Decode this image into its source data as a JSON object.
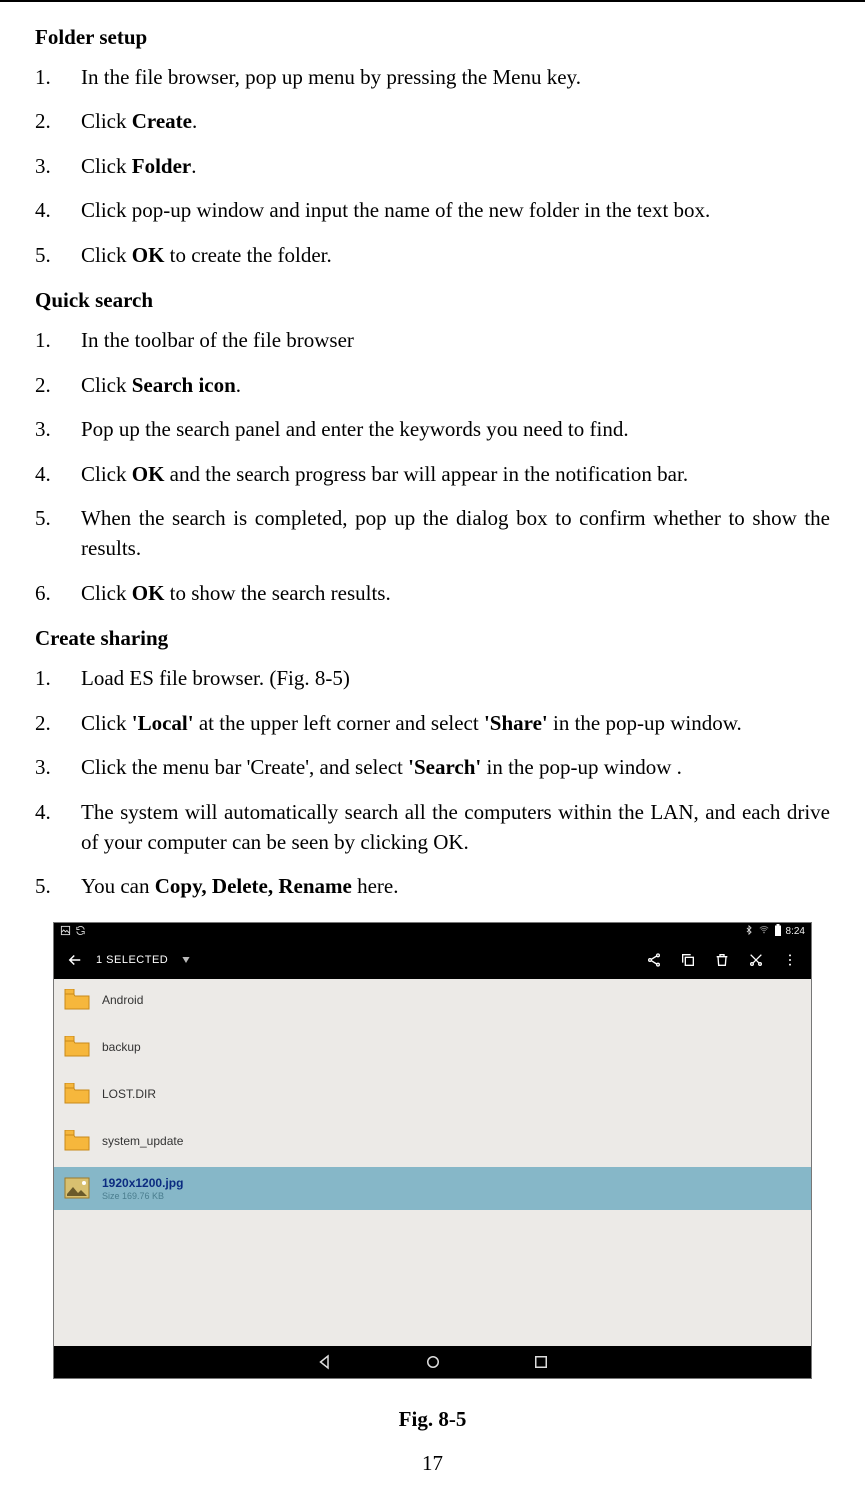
{
  "page_number": "17",
  "sections": {
    "folder_setup": {
      "title": "Folder setup",
      "items": [
        {
          "n": "1.",
          "pre": "In the file browser, pop up menu by pressing the Menu key.",
          "bold": "",
          "post": ""
        },
        {
          "n": "2.",
          "pre": "Click ",
          "bold": "Create",
          "post": "."
        },
        {
          "n": "3.",
          "pre": "Click ",
          "bold": "Folder",
          "post": "."
        },
        {
          "n": "4.",
          "pre": "Click pop-up window and input the name of the new folder in the text box.",
          "bold": "",
          "post": ""
        },
        {
          "n": "5.",
          "pre": "Click ",
          "bold": "OK",
          "post": " to create the folder."
        }
      ]
    },
    "quick_search": {
      "title": "Quick search",
      "items": [
        {
          "n": "1.",
          "pre": "In the toolbar of the file browser",
          "bold": "",
          "post": ""
        },
        {
          "n": "2.",
          "pre": "Click ",
          "bold": "Search icon",
          "post": "."
        },
        {
          "n": "3.",
          "pre": "Pop up the search panel and enter the keywords you need to find.",
          "bold": "",
          "post": ""
        },
        {
          "n": "4.",
          "pre": "Click ",
          "bold": "OK",
          "post": " and the search progress bar will appear in the notification bar."
        },
        {
          "n": "5.",
          "pre": "When the search is completed, pop up the dialog box to confirm whether to show the results.",
          "bold": "",
          "post": ""
        },
        {
          "n": "6.",
          "pre": "Click ",
          "bold": "OK",
          "post": " to show the search results."
        }
      ]
    },
    "create_sharing": {
      "title": "Create sharing",
      "items": [
        {
          "n": "1.",
          "pre": "Load ES file browser. (Fig. 8-5)",
          "bold": "",
          "post": ""
        },
        {
          "n": "2.",
          "pre": "Click ",
          "bold": "'Local'",
          "post": " at the upper left corner and select ",
          "bold2": "'Share'",
          "post2": " in the pop-up window."
        },
        {
          "n": "3.",
          "pre": "Click the menu bar 'Create', and select ",
          "bold": "'Search'",
          "post": " in the pop-up window ."
        },
        {
          "n": "4.",
          "pre": "The system will automatically search all the computers within the LAN, and each drive of your computer can be seen by clicking OK.",
          "bold": "",
          "post": ""
        },
        {
          "n": "5.",
          "pre": "You can ",
          "bold": "Copy, Delete, Rename",
          "post": " here."
        }
      ]
    }
  },
  "figure": {
    "caption": "Fig. 8-5",
    "statusbar": {
      "time": "8:24"
    },
    "appbar": {
      "title": "1 SELECTED"
    },
    "rows": [
      {
        "type": "folder",
        "label": "Android",
        "sub": ""
      },
      {
        "type": "folder",
        "label": "backup",
        "sub": ""
      },
      {
        "type": "folder",
        "label": "LOST.DIR",
        "sub": ""
      },
      {
        "type": "folder",
        "label": "system_update",
        "sub": ""
      },
      {
        "type": "image",
        "label": "1920x1200.jpg",
        "sub": "Size 169.76 KB",
        "selected": true
      }
    ]
  }
}
